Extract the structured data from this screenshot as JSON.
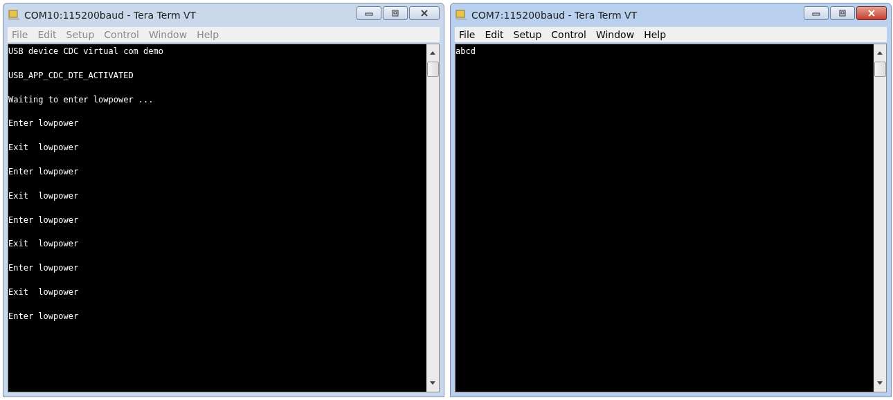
{
  "windows": [
    {
      "title": "COM10:115200baud - Tera Term VT",
      "active": false,
      "menu": [
        "File",
        "Edit",
        "Setup",
        "Control",
        "Window",
        "Help"
      ],
      "lines": [
        "USB device CDC virtual com demo",
        "USB_APP_CDC_DTE_ACTIVATED",
        "Waiting to enter lowpower ...",
        "Enter lowpower",
        "Exit  lowpower",
        "Enter lowpower",
        "Exit  lowpower",
        "Enter lowpower",
        "Exit  lowpower",
        "Enter lowpower",
        "Exit  lowpower",
        "Enter lowpower"
      ]
    },
    {
      "title": "COM7:115200baud - Tera Term VT",
      "active": true,
      "menu": [
        "File",
        "Edit",
        "Setup",
        "Control",
        "Window",
        "Help"
      ],
      "lines": [
        "abcd"
      ]
    }
  ]
}
